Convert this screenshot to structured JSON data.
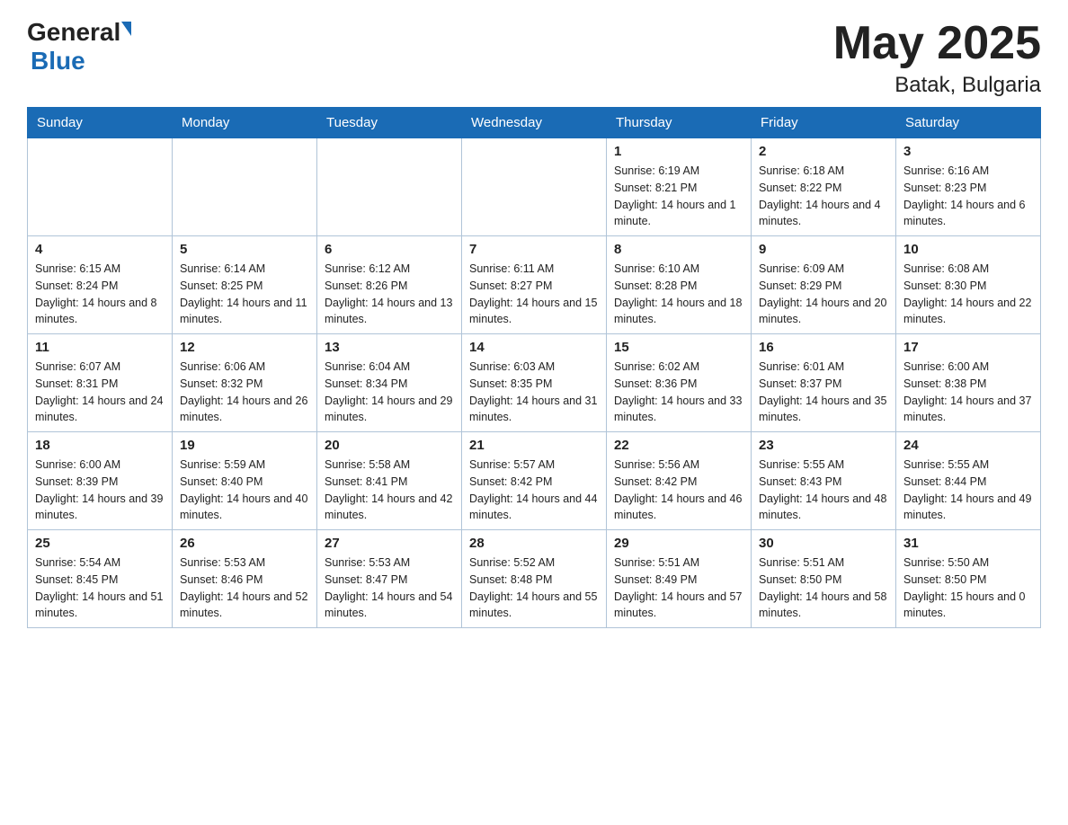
{
  "header": {
    "logo_general": "General",
    "logo_blue": "Blue",
    "month_title": "May 2025",
    "location": "Batak, Bulgaria"
  },
  "days_of_week": [
    "Sunday",
    "Monday",
    "Tuesday",
    "Wednesday",
    "Thursday",
    "Friday",
    "Saturday"
  ],
  "weeks": [
    [
      {
        "day": "",
        "info": ""
      },
      {
        "day": "",
        "info": ""
      },
      {
        "day": "",
        "info": ""
      },
      {
        "day": "",
        "info": ""
      },
      {
        "day": "1",
        "info": "Sunrise: 6:19 AM\nSunset: 8:21 PM\nDaylight: 14 hours and 1 minute."
      },
      {
        "day": "2",
        "info": "Sunrise: 6:18 AM\nSunset: 8:22 PM\nDaylight: 14 hours and 4 minutes."
      },
      {
        "day": "3",
        "info": "Sunrise: 6:16 AM\nSunset: 8:23 PM\nDaylight: 14 hours and 6 minutes."
      }
    ],
    [
      {
        "day": "4",
        "info": "Sunrise: 6:15 AM\nSunset: 8:24 PM\nDaylight: 14 hours and 8 minutes."
      },
      {
        "day": "5",
        "info": "Sunrise: 6:14 AM\nSunset: 8:25 PM\nDaylight: 14 hours and 11 minutes."
      },
      {
        "day": "6",
        "info": "Sunrise: 6:12 AM\nSunset: 8:26 PM\nDaylight: 14 hours and 13 minutes."
      },
      {
        "day": "7",
        "info": "Sunrise: 6:11 AM\nSunset: 8:27 PM\nDaylight: 14 hours and 15 minutes."
      },
      {
        "day": "8",
        "info": "Sunrise: 6:10 AM\nSunset: 8:28 PM\nDaylight: 14 hours and 18 minutes."
      },
      {
        "day": "9",
        "info": "Sunrise: 6:09 AM\nSunset: 8:29 PM\nDaylight: 14 hours and 20 minutes."
      },
      {
        "day": "10",
        "info": "Sunrise: 6:08 AM\nSunset: 8:30 PM\nDaylight: 14 hours and 22 minutes."
      }
    ],
    [
      {
        "day": "11",
        "info": "Sunrise: 6:07 AM\nSunset: 8:31 PM\nDaylight: 14 hours and 24 minutes."
      },
      {
        "day": "12",
        "info": "Sunrise: 6:06 AM\nSunset: 8:32 PM\nDaylight: 14 hours and 26 minutes."
      },
      {
        "day": "13",
        "info": "Sunrise: 6:04 AM\nSunset: 8:34 PM\nDaylight: 14 hours and 29 minutes."
      },
      {
        "day": "14",
        "info": "Sunrise: 6:03 AM\nSunset: 8:35 PM\nDaylight: 14 hours and 31 minutes."
      },
      {
        "day": "15",
        "info": "Sunrise: 6:02 AM\nSunset: 8:36 PM\nDaylight: 14 hours and 33 minutes."
      },
      {
        "day": "16",
        "info": "Sunrise: 6:01 AM\nSunset: 8:37 PM\nDaylight: 14 hours and 35 minutes."
      },
      {
        "day": "17",
        "info": "Sunrise: 6:00 AM\nSunset: 8:38 PM\nDaylight: 14 hours and 37 minutes."
      }
    ],
    [
      {
        "day": "18",
        "info": "Sunrise: 6:00 AM\nSunset: 8:39 PM\nDaylight: 14 hours and 39 minutes."
      },
      {
        "day": "19",
        "info": "Sunrise: 5:59 AM\nSunset: 8:40 PM\nDaylight: 14 hours and 40 minutes."
      },
      {
        "day": "20",
        "info": "Sunrise: 5:58 AM\nSunset: 8:41 PM\nDaylight: 14 hours and 42 minutes."
      },
      {
        "day": "21",
        "info": "Sunrise: 5:57 AM\nSunset: 8:42 PM\nDaylight: 14 hours and 44 minutes."
      },
      {
        "day": "22",
        "info": "Sunrise: 5:56 AM\nSunset: 8:42 PM\nDaylight: 14 hours and 46 minutes."
      },
      {
        "day": "23",
        "info": "Sunrise: 5:55 AM\nSunset: 8:43 PM\nDaylight: 14 hours and 48 minutes."
      },
      {
        "day": "24",
        "info": "Sunrise: 5:55 AM\nSunset: 8:44 PM\nDaylight: 14 hours and 49 minutes."
      }
    ],
    [
      {
        "day": "25",
        "info": "Sunrise: 5:54 AM\nSunset: 8:45 PM\nDaylight: 14 hours and 51 minutes."
      },
      {
        "day": "26",
        "info": "Sunrise: 5:53 AM\nSunset: 8:46 PM\nDaylight: 14 hours and 52 minutes."
      },
      {
        "day": "27",
        "info": "Sunrise: 5:53 AM\nSunset: 8:47 PM\nDaylight: 14 hours and 54 minutes."
      },
      {
        "day": "28",
        "info": "Sunrise: 5:52 AM\nSunset: 8:48 PM\nDaylight: 14 hours and 55 minutes."
      },
      {
        "day": "29",
        "info": "Sunrise: 5:51 AM\nSunset: 8:49 PM\nDaylight: 14 hours and 57 minutes."
      },
      {
        "day": "30",
        "info": "Sunrise: 5:51 AM\nSunset: 8:50 PM\nDaylight: 14 hours and 58 minutes."
      },
      {
        "day": "31",
        "info": "Sunrise: 5:50 AM\nSunset: 8:50 PM\nDaylight: 15 hours and 0 minutes."
      }
    ]
  ]
}
